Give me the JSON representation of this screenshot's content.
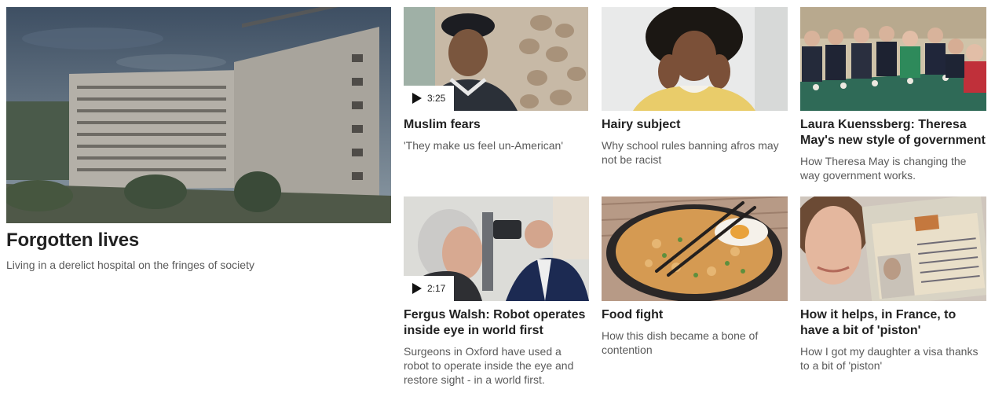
{
  "feature": {
    "title": "Forgotten lives",
    "summary": "Living in a derelict hospital on the fringes of society"
  },
  "stories": [
    {
      "title": "Muslim fears",
      "summary": "'They make us feel un-American'",
      "duration": "3:25",
      "image": "man-in-cap-photo"
    },
    {
      "title": "Hairy subject",
      "summary": "Why school rules banning afros may not be racist",
      "image": "girl-thinking-photo"
    },
    {
      "title": "Laura Kuenssberg: Theresa May's new style of government",
      "summary": "How Theresa May is changing the way government works.",
      "image": "cabinet-meeting-photo"
    },
    {
      "title": "Fergus Walsh: Robot operates inside eye in world first",
      "summary": "Surgeons in Oxford have used a robot to operate inside the eye and restore sight - in a world first.",
      "duration": "2:17",
      "image": "eye-exam-photo"
    },
    {
      "title": "Food fight",
      "summary": "How this dish became a bone of contention",
      "image": "rice-dish-photo"
    },
    {
      "title": "How it helps, in France, to have a bit of 'piston'",
      "summary": "How I got my daughter a visa thanks to a bit of 'piston'",
      "image": "visa-document-photo"
    }
  ],
  "colors": {
    "headline": "#222222",
    "summary": "#5a5a5a"
  }
}
